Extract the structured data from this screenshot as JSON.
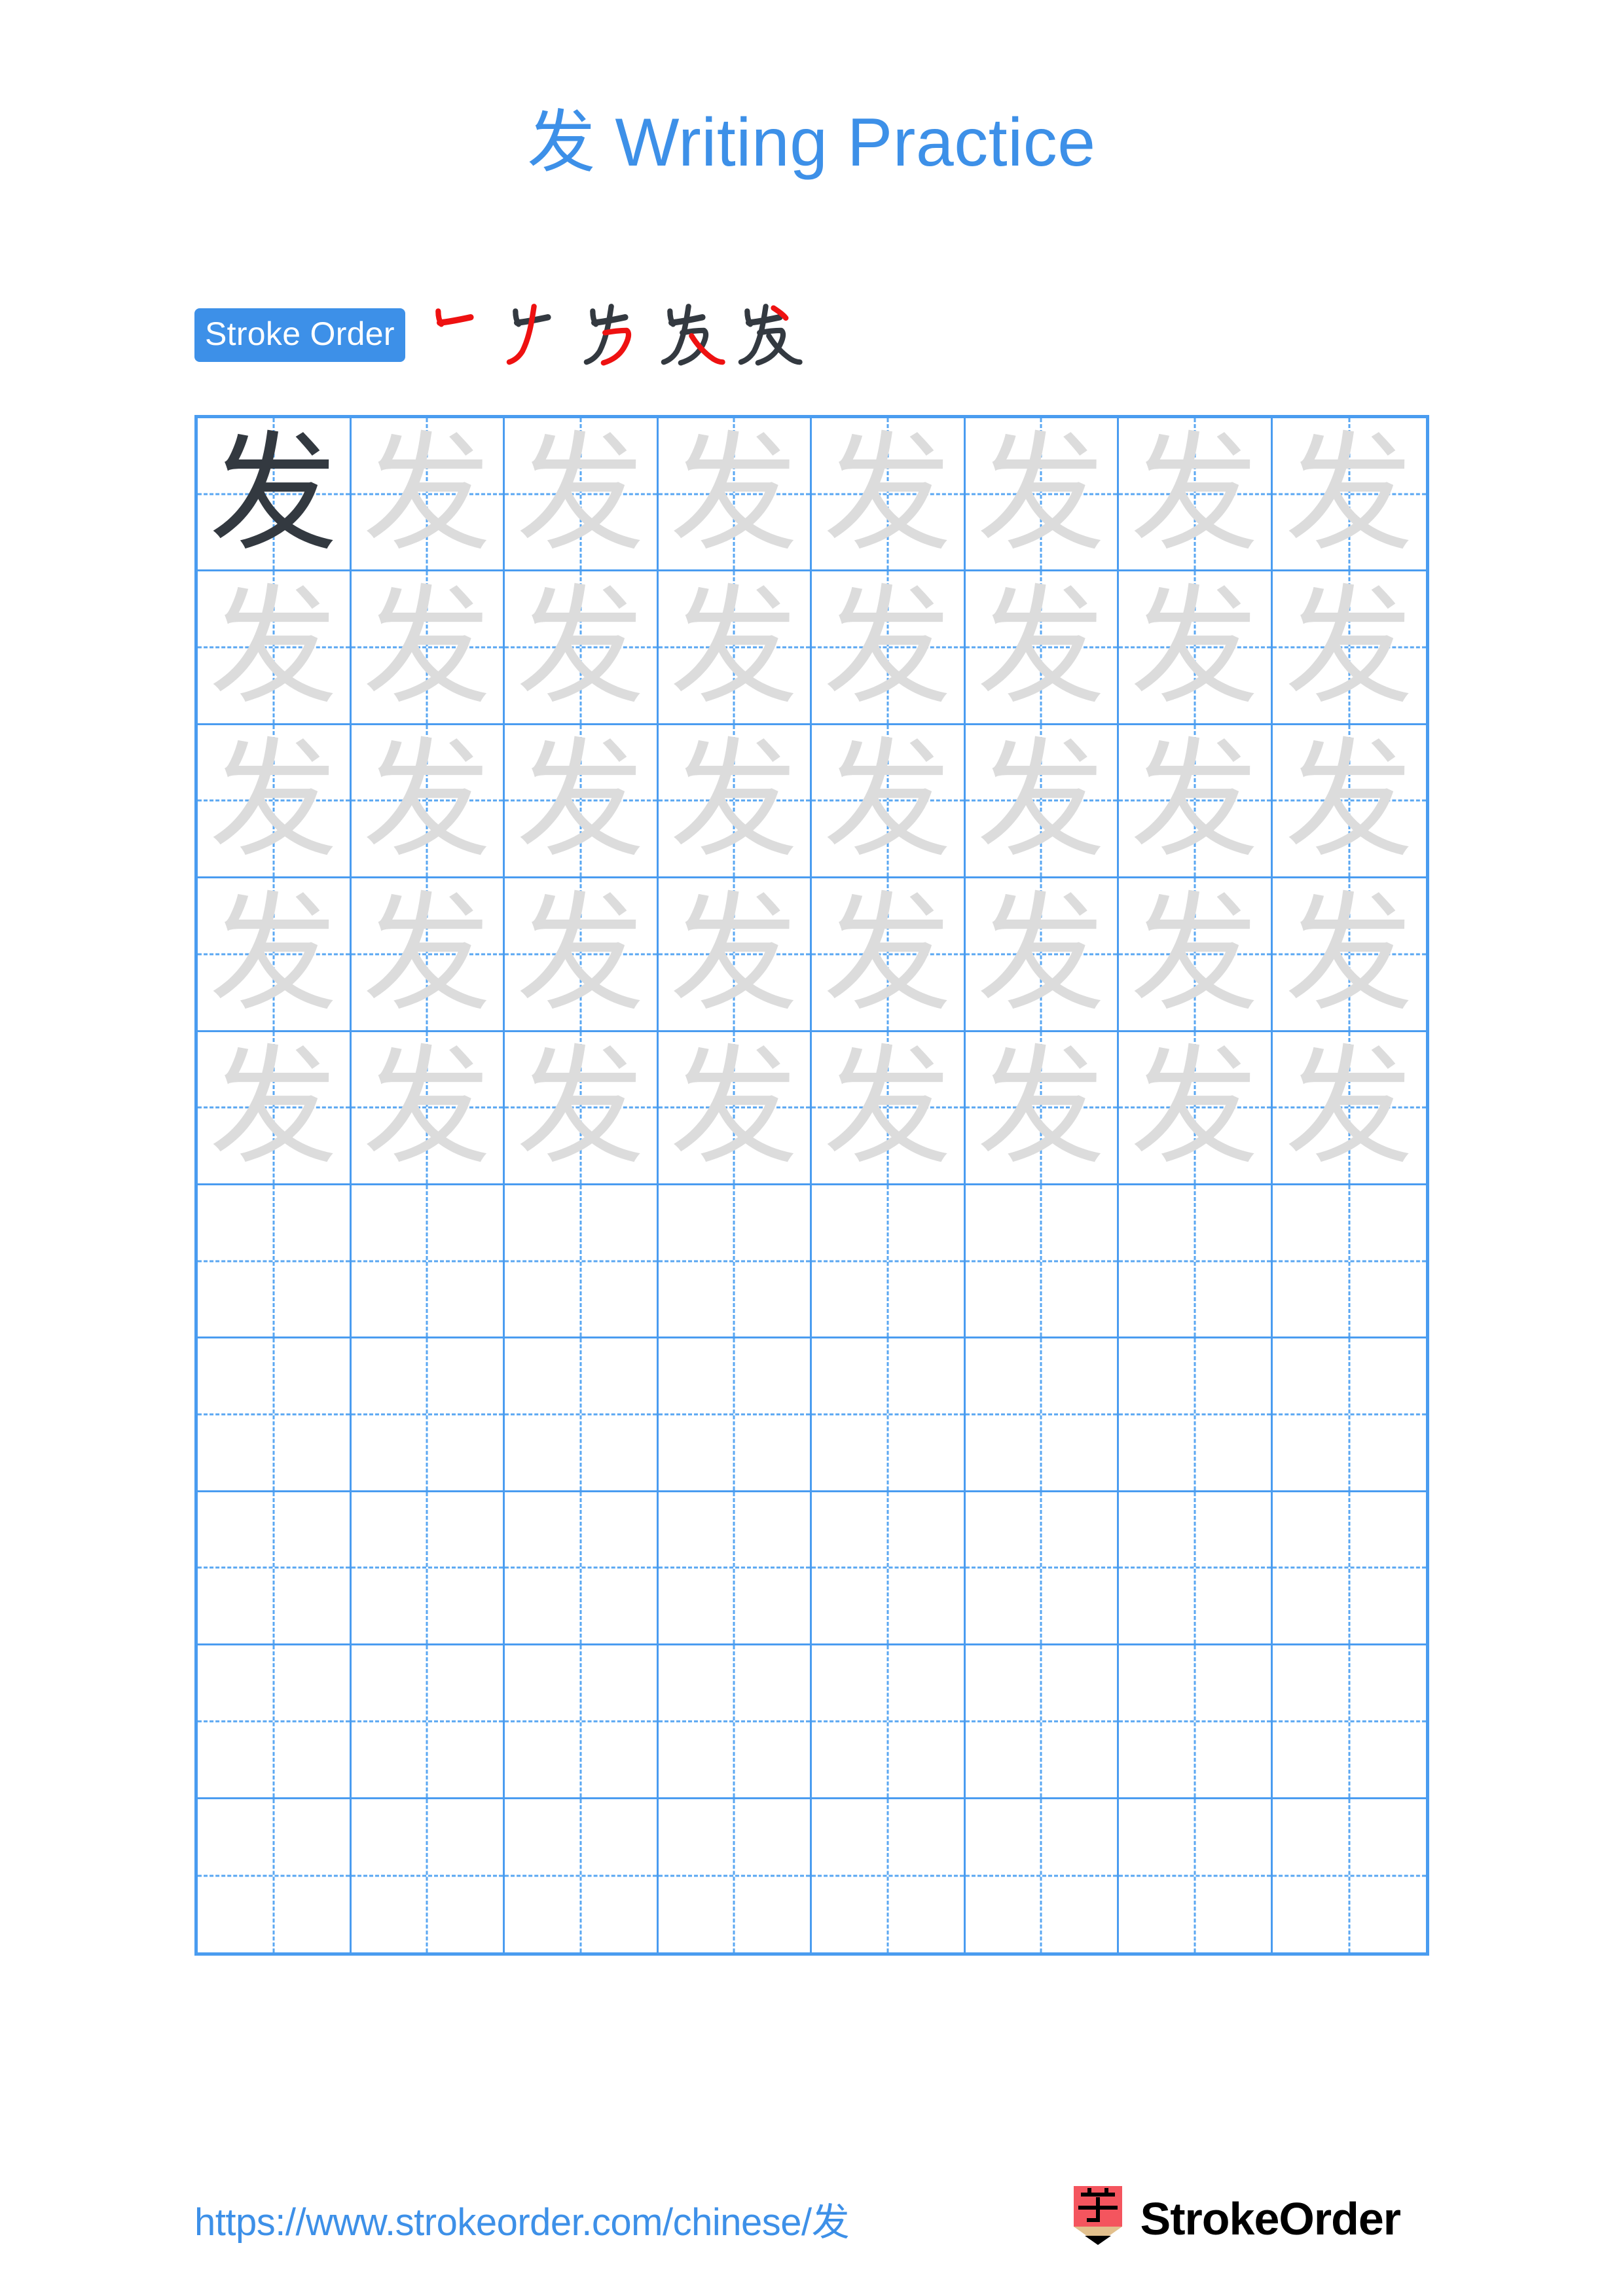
{
  "page": {
    "character": "发",
    "title": "发 Writing Practice",
    "title_character": "发",
    "title_text": "Writing Practice",
    "background_color": "#ffffff"
  },
  "colors": {
    "accent_blue": "#3d90e8",
    "grid_blue": "#4a9cf0",
    "guide_blue": "#5aa7f2",
    "trace_gray": "#dcdcdc",
    "ink_dark": "#333940",
    "stroke_new_red": "#ee1111",
    "stroke_old_dark": "#333940",
    "logo_red": "#f4555e",
    "logo_wood": "#e2c08d",
    "logo_black": "#000000"
  },
  "stroke_order": {
    "badge_label": "Stroke Order",
    "total_strokes": 5,
    "steps": [
      {
        "index": 1,
        "new_stroke_color": "#ee1111",
        "cumulative_strokes": 1,
        "label": "stroke-1"
      },
      {
        "index": 2,
        "new_stroke_color": "#ee1111",
        "cumulative_strokes": 2,
        "label": "stroke-2"
      },
      {
        "index": 3,
        "new_stroke_color": "#ee1111",
        "cumulative_strokes": 3,
        "label": "stroke-3"
      },
      {
        "index": 4,
        "new_stroke_color": "#ee1111",
        "cumulative_strokes": 4,
        "label": "stroke-4"
      },
      {
        "index": 5,
        "new_stroke_color": "#333940",
        "cumulative_strokes": 5,
        "label": "stroke-5"
      }
    ]
  },
  "grid": {
    "columns": 8,
    "rows": 10,
    "filled_rows": 5,
    "empty_rows": 5,
    "guide_style": "dashed-crosshair",
    "cells": [
      [
        "dark",
        "light",
        "light",
        "light",
        "light",
        "light",
        "light",
        "light"
      ],
      [
        "light",
        "light",
        "light",
        "light",
        "light",
        "light",
        "light",
        "light"
      ],
      [
        "light",
        "light",
        "light",
        "light",
        "light",
        "light",
        "light",
        "light"
      ],
      [
        "light",
        "light",
        "light",
        "light",
        "light",
        "light",
        "light",
        "light"
      ],
      [
        "light",
        "light",
        "light",
        "light",
        "light",
        "light",
        "light",
        "light"
      ],
      [
        "empty",
        "empty",
        "empty",
        "empty",
        "empty",
        "empty",
        "empty",
        "empty"
      ],
      [
        "empty",
        "empty",
        "empty",
        "empty",
        "empty",
        "empty",
        "empty",
        "empty"
      ],
      [
        "empty",
        "empty",
        "empty",
        "empty",
        "empty",
        "empty",
        "empty",
        "empty"
      ],
      [
        "empty",
        "empty",
        "empty",
        "empty",
        "empty",
        "empty",
        "empty",
        "empty"
      ],
      [
        "empty",
        "empty",
        "empty",
        "empty",
        "empty",
        "empty",
        "empty",
        "empty"
      ]
    ]
  },
  "footer": {
    "url": "https://www.strokeorder.com/chinese/发",
    "brand_name": "StrokeOrder",
    "brand_mark_character": "字"
  }
}
